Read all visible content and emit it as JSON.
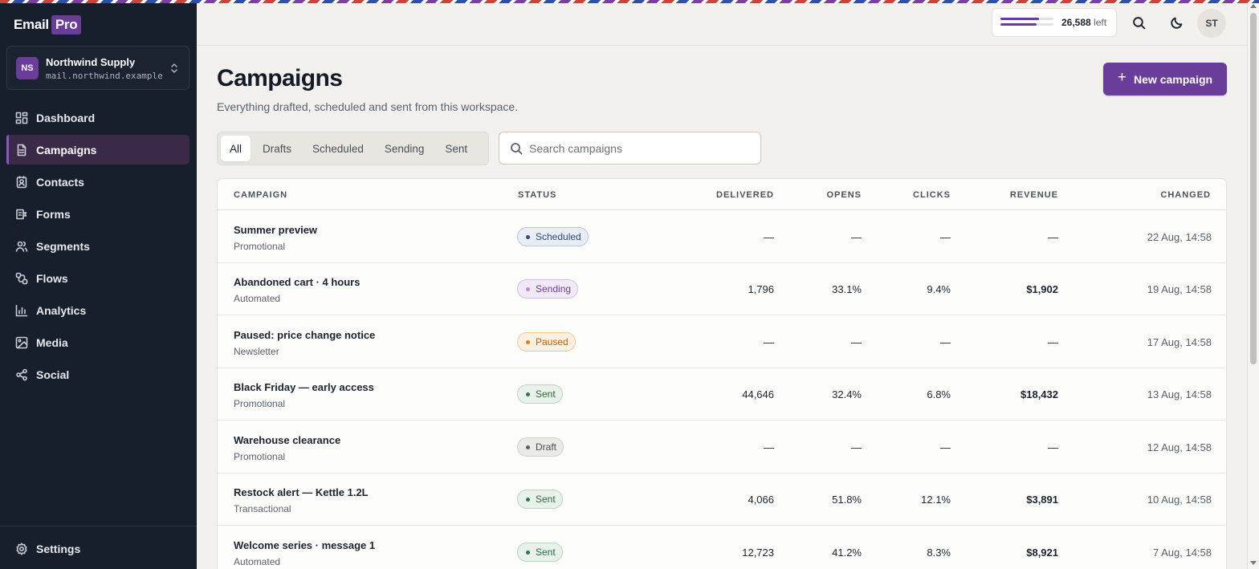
{
  "brand": {
    "name": "Email",
    "badge": "Pro",
    "accent": "#6a3d9a"
  },
  "workspace": {
    "initials": "NS",
    "name": "Northwind Supply",
    "domain": "mail.northwind.example"
  },
  "nav": [
    {
      "label": "Dashboard",
      "icon": "dashboard-icon"
    },
    {
      "label": "Campaigns",
      "icon": "document-icon",
      "active": true
    },
    {
      "label": "Contacts",
      "icon": "contacts-icon"
    },
    {
      "label": "Forms",
      "icon": "forms-icon"
    },
    {
      "label": "Segments",
      "icon": "users-icon"
    },
    {
      "label": "Flows",
      "icon": "flows-icon"
    },
    {
      "label": "Analytics",
      "icon": "bar-chart-icon"
    },
    {
      "label": "Media",
      "icon": "image-icon"
    },
    {
      "label": "Social",
      "icon": "share-icon"
    }
  ],
  "settings_label": "Settings",
  "topbar": {
    "quota_value": "26,588",
    "quota_suffix": "left",
    "quota_used_fraction": 0.72,
    "quota_second_fraction": 0.68,
    "user_initials": "ST"
  },
  "header": {
    "title": "Campaigns",
    "subtitle": "Everything drafted, scheduled and sent from this workspace.",
    "new_button": "New campaign"
  },
  "tabs": [
    "All",
    "Drafts",
    "Scheduled",
    "Sending",
    "Sent"
  ],
  "active_tab": "All",
  "search": {
    "placeholder": "Search campaigns"
  },
  "table": {
    "columns": [
      "Campaign",
      "Status",
      "Delivered",
      "Opens",
      "Clicks",
      "Revenue",
      "Changed"
    ],
    "rows": [
      {
        "name": "Summer preview",
        "type": "Promotional",
        "status": "Scheduled",
        "delivered": "—",
        "opens": "—",
        "clicks": "—",
        "revenue": "—",
        "changed": "22 Aug, 14:58"
      },
      {
        "name": "Abandoned cart · 4 hours",
        "type": "Automated",
        "status": "Sending",
        "delivered": "1,796",
        "opens": "33.1%",
        "clicks": "9.4%",
        "revenue": "$1,902",
        "changed": "19 Aug, 14:58"
      },
      {
        "name": "Paused: price change notice",
        "type": "Newsletter",
        "status": "Paused",
        "delivered": "—",
        "opens": "—",
        "clicks": "—",
        "revenue": "—",
        "changed": "17 Aug, 14:58"
      },
      {
        "name": "Black Friday — early access",
        "type": "Promotional",
        "status": "Sent",
        "delivered": "44,646",
        "opens": "32.4%",
        "clicks": "6.8%",
        "revenue": "$18,432",
        "changed": "13 Aug, 14:58"
      },
      {
        "name": "Warehouse clearance",
        "type": "Promotional",
        "status": "Draft",
        "delivered": "—",
        "opens": "—",
        "clicks": "—",
        "revenue": "—",
        "changed": "12 Aug, 14:58"
      },
      {
        "name": "Restock alert — Kettle 1.2L",
        "type": "Transactional",
        "status": "Sent",
        "delivered": "4,066",
        "opens": "51.8%",
        "clicks": "12.1%",
        "revenue": "$3,891",
        "changed": "10 Aug, 14:58"
      },
      {
        "name": "Welcome series · message 1",
        "type": "Automated",
        "status": "Sent",
        "delivered": "12,723",
        "opens": "41.2%",
        "clicks": "8.3%",
        "revenue": "$8,921",
        "changed": "7 Aug, 14:58"
      }
    ]
  },
  "status_colors": {
    "Scheduled": {
      "bg": "#e8edf6",
      "border": "#b9c6e0",
      "text": "#2e4a80",
      "dot": "#2e4a80"
    },
    "Sending": {
      "bg": "#f1e9f6",
      "border": "#d5c0e4",
      "text": "#6a3d9a",
      "dot": "#b88ad6"
    },
    "Paused": {
      "bg": "#fdf0e1",
      "border": "#efc99a",
      "text": "#b5650f",
      "dot": "#d9821c"
    },
    "Sent": {
      "bg": "#e8f2ea",
      "border": "#b9d7c0",
      "text": "#2c6a3c",
      "dot": "#2c7a44"
    },
    "Draft": {
      "bg": "#ebeae7",
      "border": "#d2d0cb",
      "text": "#4b4f57",
      "dot": "#5a5e66"
    }
  }
}
